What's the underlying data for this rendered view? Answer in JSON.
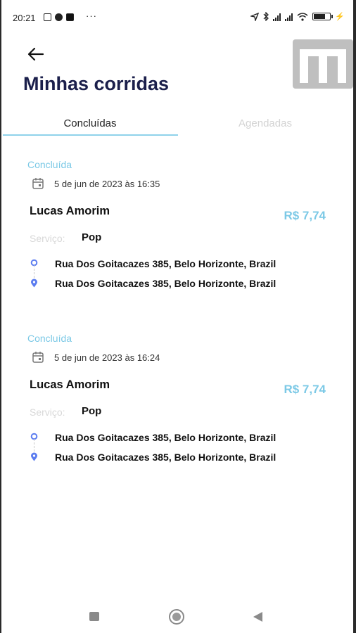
{
  "status_bar": {
    "time": "20:21",
    "dots": "···",
    "signal_label_1": "ill",
    "signal_label_2": "ill"
  },
  "header": {
    "title": "Minhas corridas",
    "back_icon": "arrow-left-icon"
  },
  "tabs": [
    {
      "label": "Concluídas",
      "active": true
    },
    {
      "label": "Agendadas",
      "active": false
    }
  ],
  "rides": [
    {
      "status": "Concluída",
      "date": "5 de jun de 2023 às 16:35",
      "driver": "Lucas Amorim",
      "price": "R$ 7,74",
      "service_label": "Serviço:",
      "service": "Pop",
      "origin": "Rua Dos Goitacazes 385, Belo Horizonte, Brazil",
      "destination": "Rua Dos Goitacazes 385, Belo Horizonte, Brazil"
    },
    {
      "status": "Concluída",
      "date": "5 de jun de 2023 às 16:24",
      "driver": "Lucas Amorim",
      "price": "R$ 7,74",
      "service_label": "Serviço:",
      "service": "Pop",
      "origin": "Rua Dos Goitacazes 385, Belo Horizonte, Brazil",
      "destination": "Rua Dos Goitacazes 385, Belo Horizonte, Brazil"
    }
  ],
  "colors": {
    "accent": "#7cc9e6",
    "title": "#1b1f4b",
    "pin": "#5b7cf0"
  }
}
